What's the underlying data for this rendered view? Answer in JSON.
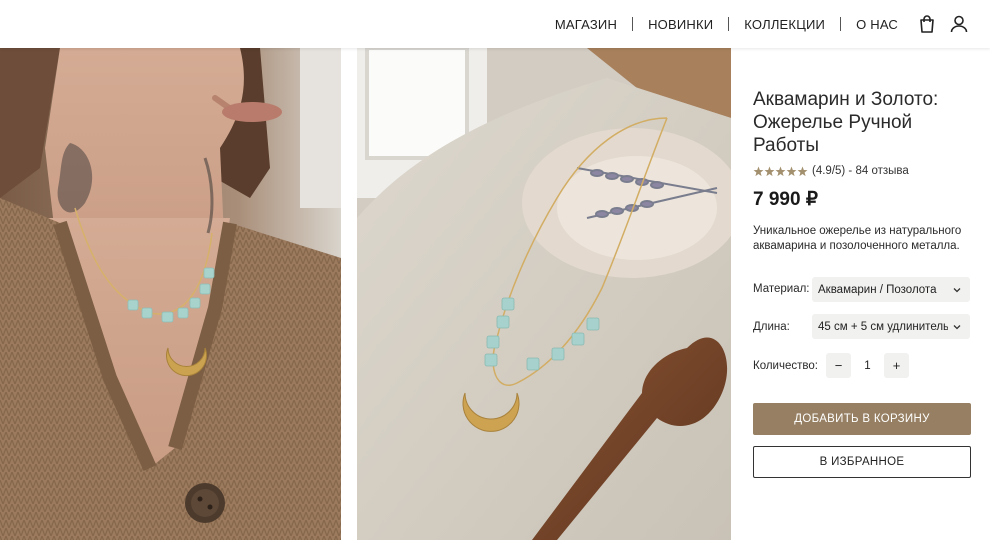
{
  "nav": {
    "items": [
      {
        "label": "МАГАЗИН"
      },
      {
        "label": "НОВИНКИ"
      },
      {
        "label": "КОЛЛЕКЦИИ"
      },
      {
        "label": "О НАС"
      }
    ],
    "icons": [
      "shopping-bag-icon",
      "user-icon"
    ]
  },
  "gallery": {
    "images": [
      {
        "name": "model-wearing-necklace-photo"
      },
      {
        "name": "necklace-on-linen-photo"
      }
    ]
  },
  "product": {
    "title": "Аквамарин и Золото: Ожерелье Ручной Работы",
    "rating": {
      "stars": 5,
      "score_text": "(4.9/5) - 84 отзыва",
      "star_color": "#a3906f"
    },
    "price": "7 990 ₽",
    "description": "Уникальное ожерелье из натурального аквамарина и позолоченного металла.",
    "options": {
      "material": {
        "label": "Материал:",
        "value": "Аквамарин / Позолота"
      },
      "length": {
        "label": "Длина:",
        "value": "45 см + 5 см удлинитель"
      }
    },
    "quantity": {
      "label": "Количество:",
      "value": "1",
      "minus": "−",
      "plus": "+"
    },
    "add_to_cart": "ДОБАВИТЬ В КОРЗИНУ",
    "favorite": "В ИЗБРАННОЕ"
  },
  "colors": {
    "accent": "#967f62"
  }
}
